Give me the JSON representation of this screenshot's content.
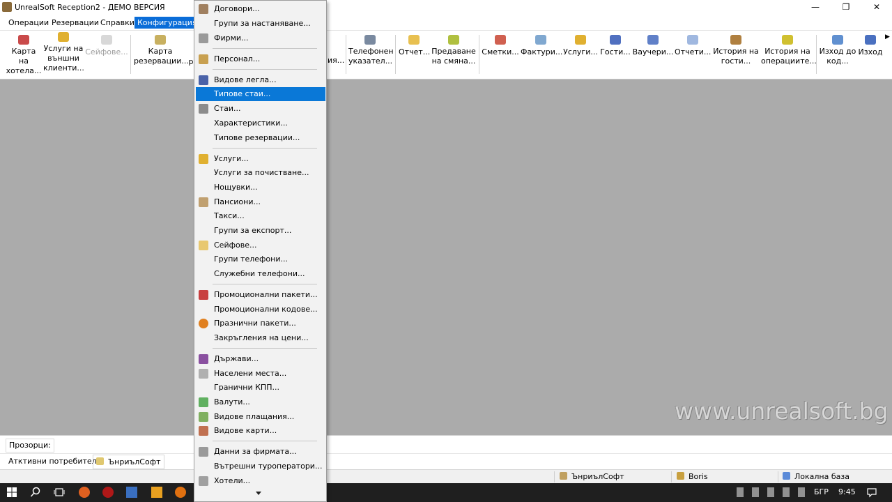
{
  "window": {
    "title": "UnrealSoft Reception2 - ДЕМО ВЕРСИЯ",
    "minimize": "—",
    "restore": "❐",
    "close": "✕"
  },
  "menubar": [
    "Операции",
    "Резервации",
    "Справки",
    "Конфигурация"
  ],
  "toolbar": [
    {
      "line1": "Карта на",
      "line2": "хотела..."
    },
    {
      "line1": "Услуги на",
      "line2": "външни",
      "line3": "клиенти..."
    },
    {
      "line1": "Сейфове..."
    },
    {
      "line1": "Карта",
      "line2": "резервации..."
    },
    {
      "line1": "р"
    },
    {
      "line1": "ия..."
    },
    {
      "line1": "Телефонен",
      "line2": "указател..."
    },
    {
      "line1": "Отчет..."
    },
    {
      "line1": "Предаване",
      "line2": "на смяна..."
    },
    {
      "line1": "Сметки..."
    },
    {
      "line1": "Фактури..."
    },
    {
      "line1": "Услуги..."
    },
    {
      "line1": "Гости..."
    },
    {
      "line1": "Ваучери..."
    },
    {
      "line1": "Отчети..."
    },
    {
      "line1": "История на",
      "line2": "гости..."
    },
    {
      "line1": "История на",
      "line2": "операциите..."
    },
    {
      "line1": "Изход до",
      "line2": "код..."
    },
    {
      "line1": "Изход"
    }
  ],
  "config_menu": {
    "items": [
      "Договори...",
      "Групи за настаняване...",
      "Фирми...",
      "Персонал...",
      "Видове легла...",
      "Типове стаи...",
      "Стаи...",
      "Характеристики...",
      "Типове резервации...",
      "Услуги...",
      "Услуги за почистване...",
      "Нощувки...",
      "Пансиони...",
      "Такси...",
      "Групи за експорт...",
      "Сейфове...",
      "Групи телефони...",
      "Служебни телефони...",
      "Промоционални пакети...",
      "Промоционални кодове...",
      "Празнични пакети...",
      "Закръгления на цени...",
      "Държави...",
      "Населени места...",
      "Гранични КПП...",
      "Валути...",
      "Видове плащания...",
      "Видове карти...",
      "Данни за фирмата...",
      "Вътрешни туроператори...",
      "Хотели..."
    ],
    "selected": "Типове стаи..."
  },
  "watermark": "www.unrealsoft.bg",
  "windows_bar": {
    "label": "Прозорци:"
  },
  "users_bar": {
    "label": "Атктивни потребители:",
    "user": "ЪнриълСофт"
  },
  "statusbar": {
    "company": "ЪнриълСофт",
    "user": "Boris",
    "database": "Локална база"
  },
  "taskbar": {
    "lang": "БГР",
    "time": "9:45"
  },
  "colors": {
    "menu_highlight": "#0a6dd8",
    "dropdown_selected": "#0a78d7",
    "workspace": "#ababab"
  }
}
